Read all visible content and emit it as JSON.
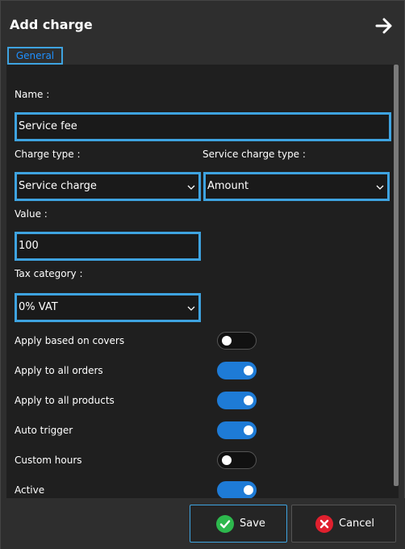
{
  "dialog": {
    "title": "Add charge"
  },
  "tabs": [
    {
      "label": "General"
    }
  ],
  "form": {
    "name": {
      "label": "Name :",
      "value": "Service fee"
    },
    "charge_type": {
      "label": "Charge type :",
      "value": "Service charge"
    },
    "service_charge_type": {
      "label": "Service charge type :",
      "value": "Amount"
    },
    "value": {
      "label": "Value :",
      "value": "100"
    },
    "tax_category": {
      "label": "Tax category :",
      "value": "0% VAT"
    },
    "toggles": [
      {
        "label": "Apply based on covers",
        "on": false
      },
      {
        "label": "Apply to all orders",
        "on": true
      },
      {
        "label": "Apply to all products",
        "on": true
      },
      {
        "label": "Auto trigger",
        "on": true
      },
      {
        "label": "Custom hours",
        "on": false
      },
      {
        "label": "Active",
        "on": true
      }
    ]
  },
  "footer": {
    "save_label": "Save",
    "cancel_label": "Cancel"
  },
  "colors": {
    "accent": "#3ea3e0",
    "toggle_on": "#1e7bd6",
    "save_icon": "#2db84d",
    "cancel_icon": "#e0202e"
  },
  "icons": {
    "back": "arrow-right-icon",
    "save": "check-circle-icon",
    "cancel": "x-circle-icon",
    "dropdown": "chevron-down-icon"
  }
}
